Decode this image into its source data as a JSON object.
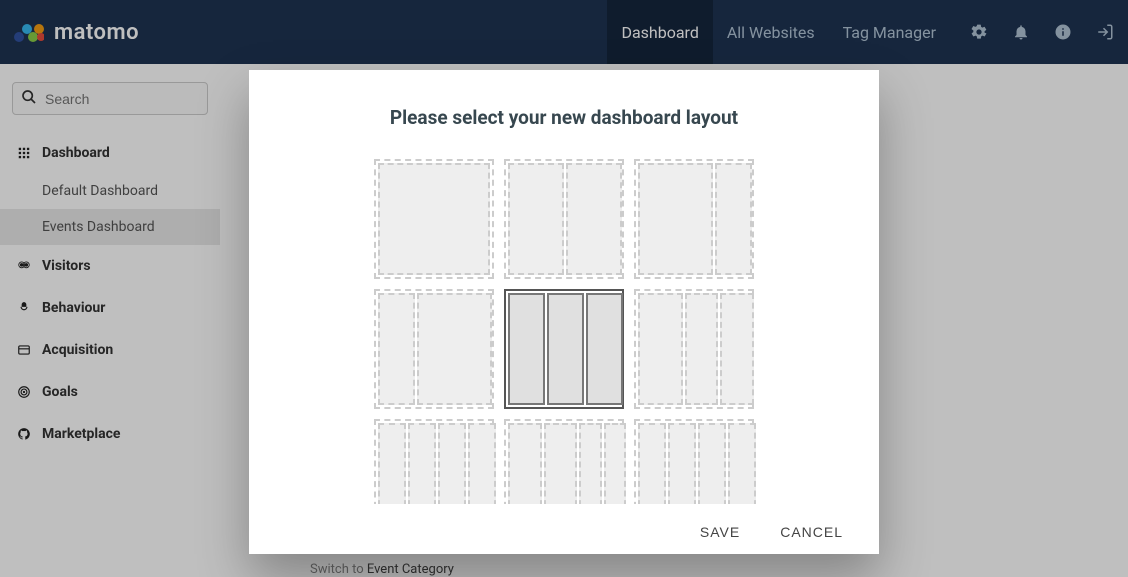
{
  "brand": "matomo",
  "header": {
    "nav": [
      {
        "label": "Dashboard",
        "active": true
      },
      {
        "label": "All Websites",
        "active": false
      },
      {
        "label": "Tag Manager",
        "active": false
      }
    ]
  },
  "search": {
    "placeholder": "Search"
  },
  "sidebar": {
    "dashboard": "Dashboard",
    "subitems": [
      {
        "label": "Default Dashboard",
        "active": false
      },
      {
        "label": "Events Dashboard",
        "active": true
      }
    ],
    "sections": [
      {
        "label": "Visitors"
      },
      {
        "label": "Behaviour"
      },
      {
        "label": "Acquisition"
      },
      {
        "label": "Goals"
      },
      {
        "label": "Marketplace"
      }
    ]
  },
  "content": {
    "switch_label": "Switch to ",
    "switch_value": "Event Category"
  },
  "modal": {
    "title": "Please select your new dashboard layout",
    "save": "SAVE",
    "cancel": "CANCEL",
    "layouts": [
      {
        "cols": [
          100
        ],
        "selected": false
      },
      {
        "cols": [
          50,
          50
        ],
        "selected": false
      },
      {
        "cols": [
          67,
          33
        ],
        "selected": false
      },
      {
        "cols": [
          33,
          67
        ],
        "selected": false
      },
      {
        "cols": [
          33,
          33,
          33
        ],
        "selected": true
      },
      {
        "cols": [
          40,
          30,
          30
        ],
        "selected": false
      },
      {
        "cols": [
          25,
          25,
          25,
          25
        ],
        "selected": false
      },
      {
        "cols": [
          30,
          30,
          20,
          20
        ],
        "selected": false
      },
      {
        "cols": [
          25,
          25,
          25,
          25
        ],
        "selected": false
      }
    ]
  }
}
